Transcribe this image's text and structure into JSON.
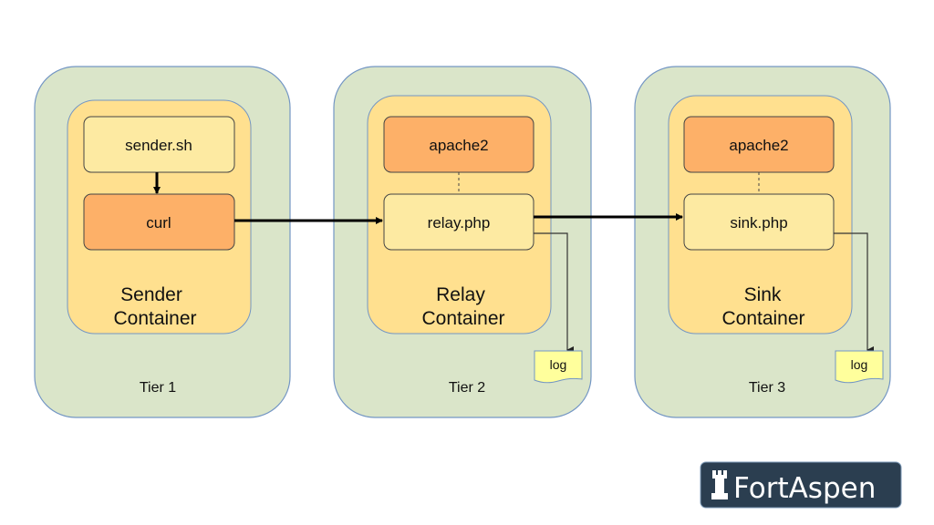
{
  "colors": {
    "tier_fill": "#dae5c9",
    "tier_stroke": "#7396c4",
    "container_fill": "#ffe08f",
    "light_box": "#fdeaa2",
    "orange_box": "#fdb068",
    "log_fill": "#ffff9c",
    "logo_bg": "#2b3e50"
  },
  "tiers": [
    {
      "label": "Tier 1",
      "container": [
        "Sender",
        "Container"
      ],
      "top_box": "sender.sh",
      "bottom_box": "curl"
    },
    {
      "label": "Tier 2",
      "container": [
        "Relay",
        "Container"
      ],
      "top_box": "apache2",
      "bottom_box": "relay.php",
      "log": "log"
    },
    {
      "label": "Tier 3",
      "container": [
        "Sink",
        "Container"
      ],
      "top_box": "apache2",
      "bottom_box": "sink.php",
      "log": "log"
    }
  ],
  "logo": {
    "text": "FortAspen",
    "icon": "rook-icon"
  }
}
